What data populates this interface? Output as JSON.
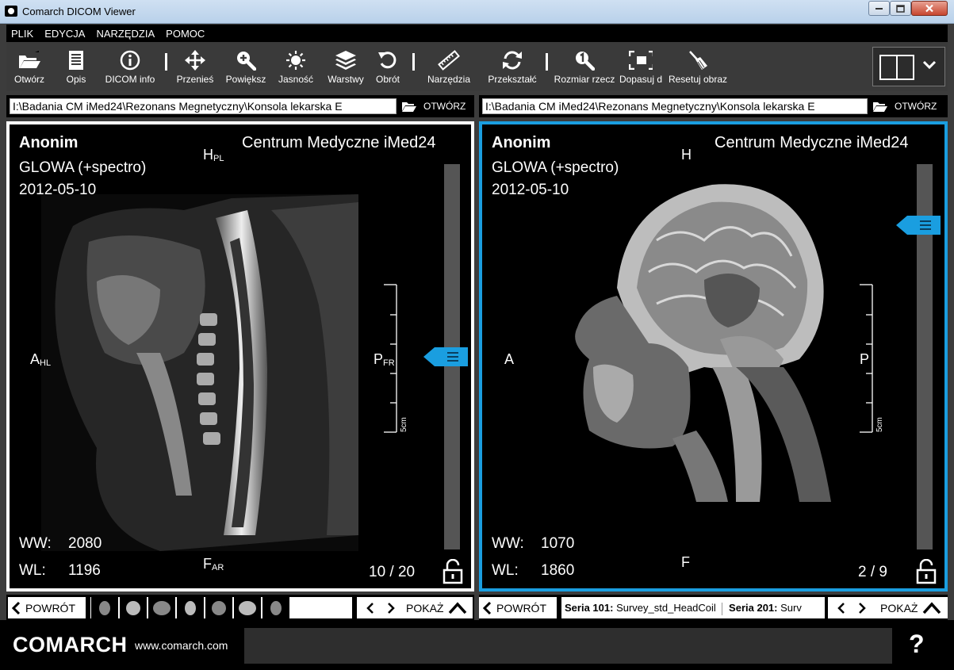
{
  "window": {
    "title": "Comarch DICOM Viewer"
  },
  "menu": [
    "PLIK",
    "EDYCJA",
    "NARZĘDZIA",
    "POMOC"
  ],
  "toolbar": {
    "open": "Otwórz",
    "description": "Opis",
    "dicom_info": "DICOM info",
    "move": "Przenieś",
    "zoom": "Powiększ",
    "brightness": "Jasność",
    "layers": "Warstwy",
    "rotate": "Obrót",
    "tools": "Narzędzia",
    "transform": "Przekształć",
    "real_size": "Rozmiar rzecz",
    "fit": "Dopasuj d",
    "reset": "Resetuj obraz"
  },
  "left_path": {
    "value": "I:\\Badania CM iMed24\\Rezonans Megnetyczny\\Konsola lekarska E",
    "open_label": "OTWÓRZ"
  },
  "right_path": {
    "value": "I:\\Badania CM iMed24\\Rezonans Megnetyczny\\Konsola lekarska E",
    "open_label": "OTWÓRZ"
  },
  "viewport_left": {
    "patient": "Anonim",
    "study": "GLOWA (+spectro)",
    "date": "2012-05-10",
    "clinic": "Centrum Medyczne iMed24",
    "top": "H",
    "top_sub": "PL",
    "left": "A",
    "left_sub": "HL",
    "right": "P",
    "right_sub": "FR",
    "bottom": "F",
    "bottom_sub": "AR",
    "ww_label": "WW:",
    "ww": "2080",
    "wl_label": "WL:",
    "wl": "1196",
    "counter": "10 / 20",
    "scale_label": "5cm",
    "slice_position": 0.5
  },
  "viewport_right": {
    "patient": "Anonim",
    "study": "GLOWA (+spectro)",
    "date": "2012-05-10",
    "clinic": "Centrum Medyczne iMed24",
    "top": "H",
    "left": "A",
    "right": "P",
    "bottom": "F",
    "ww_label": "WW:",
    "ww": "1070",
    "wl_label": "WL:",
    "wl": "1860",
    "counter": "2 / 9",
    "scale_label": "5cm",
    "slice_position": 0.14
  },
  "series_left": {
    "back": "POWRÓT",
    "show": "POKAŻ",
    "thumbnail_count": 7
  },
  "series_right": {
    "back": "POWRÓT",
    "show": "POKAŻ",
    "items": [
      {
        "label": "Seria 101:",
        "name": "Survey_std_HeadCoil"
      },
      {
        "label": "Seria 201:",
        "name": "Surv"
      }
    ]
  },
  "footer": {
    "logo": "COMARCH",
    "site": "www.comarch.com",
    "help": "?"
  },
  "colors": {
    "accent": "#1a9ee0",
    "background": "#3c3c3c"
  }
}
